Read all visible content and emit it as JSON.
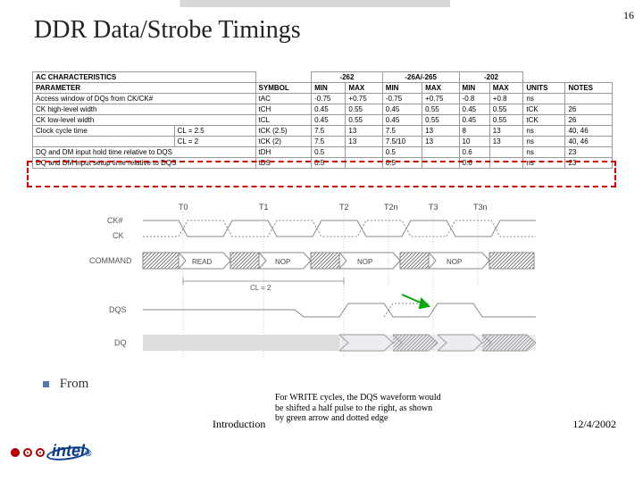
{
  "page_number": "16",
  "title": "DDR Data/Strobe Timings",
  "table": {
    "header_main": "AC CHARACTERISTICS",
    "header_param": "PARAMETER",
    "header_symbol": "SYMBOL",
    "speed_grades": [
      "-262",
      "-26A/-265",
      "-202"
    ],
    "min": "MIN",
    "max": "MAX",
    "units": "UNITS",
    "notes": "NOTES",
    "rows": [
      {
        "param": "Access window of DQs from CK/CK#",
        "sym": "tAC",
        "v": [
          "-0.75",
          "+0.75",
          "-0.75",
          "+0.75",
          "-0.8",
          "+0.8"
        ],
        "u": "ns",
        "n": ""
      },
      {
        "param": "CK high-level width",
        "sym": "tCH",
        "v": [
          "0.45",
          "0.55",
          "0.45",
          "0.55",
          "0.45",
          "0.55"
        ],
        "u": "tCK",
        "n": "26"
      },
      {
        "param": "CK low-level width",
        "sym": "tCL",
        "v": [
          "0.45",
          "0.55",
          "0.45",
          "0.55",
          "0.45",
          "0.55"
        ],
        "u": "tCK",
        "n": "26"
      },
      {
        "param": "Clock cycle time",
        "extra": "CL = 2.5",
        "sym": "tCK (2.5)",
        "v": [
          "7.5",
          "13",
          "",
          "7.5",
          "13",
          "8",
          "13"
        ],
        "u": "ns",
        "n": "40, 46"
      },
      {
        "param": "",
        "extra": "CL = 2",
        "sym": "tCK (2)",
        "v": [
          "7.5",
          "13",
          "7.5/10",
          "13",
          "10",
          "13"
        ],
        "u": "ns",
        "n": "40, 46"
      },
      {
        "param": "DQ and DM input hold time relative to DQS",
        "sym": "tDH",
        "v": [
          "0.5",
          "",
          "0.5",
          "",
          "0.6",
          ""
        ],
        "u": "ns",
        "n": "23"
      },
      {
        "param": "DQ and DM input setup time relative to DQS",
        "sym": "tDS",
        "v": [
          "0.5",
          "",
          "0.5",
          "",
          "0.6",
          ""
        ],
        "u": "ns",
        "n": "23"
      }
    ]
  },
  "timing": {
    "labels_t": [
      "T0",
      "T1",
      "T2",
      "T2n",
      "T3",
      "T3n"
    ],
    "sig_ckh": "CK#",
    "sig_ck": "CK",
    "sig_cmd": "COMMAND",
    "sig_dqs": "DQS",
    "sig_dq": "DQ",
    "cmds": [
      "READ",
      "NOP",
      "NOP",
      "NOP"
    ],
    "cl_note": "CL = 2"
  },
  "bullet": {
    "text": "From "
  },
  "bullet_obscured": "......... ........",
  "note_lines": [
    "For WRITE cycles, the DQS waveform would",
    "be shifted a half pulse to the right, as shown",
    "by green arrow and dotted edge"
  ],
  "footer_intro": "Introduction",
  "footer_date": "12/4/2002",
  "brand": "intel",
  "brand_sub": "®"
}
